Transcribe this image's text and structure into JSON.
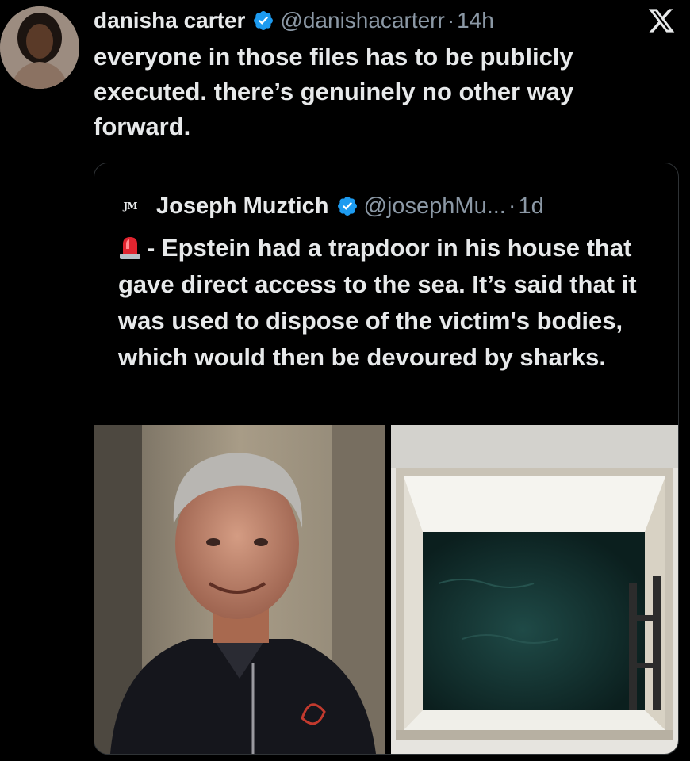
{
  "tweet": {
    "author_name": "danisha carter",
    "author_handle": "@danishacarterr",
    "separator": "·",
    "time": "14h",
    "text": "everyone in those files has to be publicly executed. there’s genuinely no other way forward."
  },
  "quoted_tweet": {
    "avatar_initials": "JM",
    "author_name": "Joseph Muztich",
    "author_handle": "@josephMu...",
    "separator": "·",
    "time": "1d",
    "text": "- Epstein had a trapdoor in his house that gave direct access to the sea. It’s said that it was used to dispose of the victim's bodies, which would then be devoured by sharks."
  },
  "icons": {
    "verified": "verified-badge-icon",
    "platform": "x-logo-icon",
    "siren": "police-siren-emoji-icon"
  },
  "colors": {
    "background": "#000000",
    "text": "#e7e9ea",
    "secondary_text": "#8b98a5",
    "verified_blue": "#1d9bf0",
    "border": "#2f3336"
  }
}
